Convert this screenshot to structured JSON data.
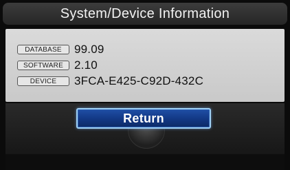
{
  "header": {
    "title": "System/Device Information"
  },
  "info": {
    "rows": [
      {
        "label": "DATABASE",
        "value": "99.09"
      },
      {
        "label": "SOFTWARE",
        "value": "2.10"
      },
      {
        "label": "DEVICE",
        "value": "3FCA-E425-C92D-432C"
      }
    ]
  },
  "actions": {
    "return_label": "Return"
  },
  "colors": {
    "title_bar": "#2f2f2f",
    "panel_background": "#d3d3d3",
    "button_fill": "#123783",
    "button_border": "#9fd0f5"
  }
}
